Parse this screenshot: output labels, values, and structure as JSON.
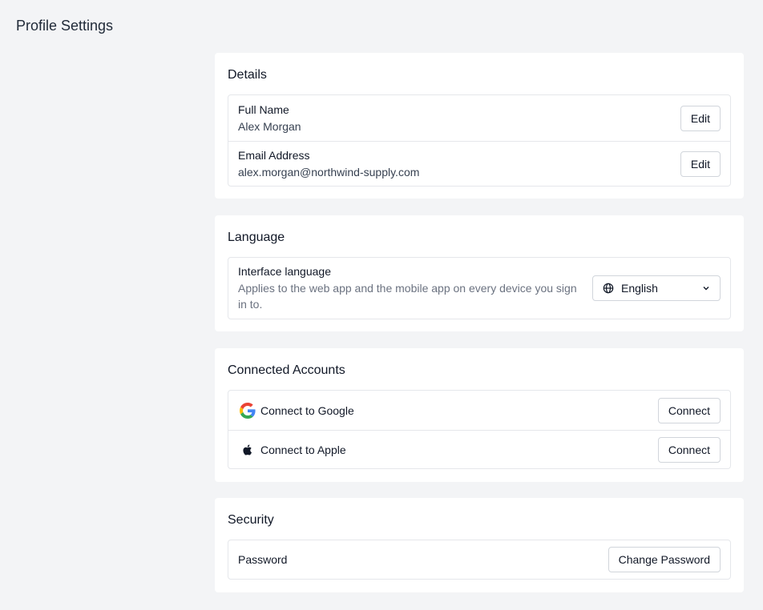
{
  "page": {
    "title": "Profile Settings"
  },
  "details": {
    "title": "Details",
    "full_name": {
      "label": "Full Name",
      "value": "Alex Morgan",
      "button": "Edit"
    },
    "email": {
      "label": "Email Address",
      "value": "alex.morgan@northwind-supply.com",
      "button": "Edit"
    }
  },
  "language": {
    "title": "Language",
    "label": "Interface language",
    "description": "Applies to the web app and the mobile app on every device you sign in to.",
    "selected": "English",
    "icon": "globe-icon"
  },
  "connected_accounts": {
    "title": "Connected Accounts",
    "items": [
      {
        "label": "Connect to Google",
        "button": "Connect",
        "icon": "google-icon"
      },
      {
        "label": "Connect to Apple",
        "button": "Connect",
        "icon": "apple-icon"
      }
    ]
  },
  "security": {
    "title": "Security",
    "password": {
      "label": "Password",
      "button": "Change Password"
    }
  },
  "colors": {
    "background": "#f3f4f6",
    "card": "#ffffff",
    "border": "#e5e7eb",
    "text": "#111827",
    "muted": "#6b7280"
  }
}
